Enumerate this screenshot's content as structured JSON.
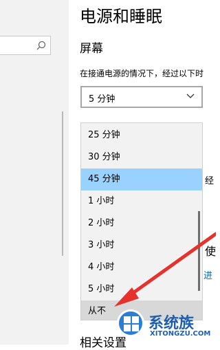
{
  "sidebar": {
    "search_icon": "search-icon"
  },
  "header": {
    "title": "电源和睡眠"
  },
  "screen": {
    "section_title": "屏幕",
    "description": "在接通电源的情况下，经过以下时",
    "select": {
      "value": "5 分钟",
      "icon": "chevron-down-icon"
    },
    "dropdown": {
      "options": [
        {
          "label": "25 分钟",
          "state": "normal"
        },
        {
          "label": "30 分钟",
          "state": "normal"
        },
        {
          "label": "45 分钟",
          "state": "selected"
        },
        {
          "label": "1 小时",
          "state": "normal"
        },
        {
          "label": "2 小时",
          "state": "normal"
        },
        {
          "label": "3 小时",
          "state": "normal"
        },
        {
          "label": "4 小时",
          "state": "normal"
        },
        {
          "label": "5 小时",
          "state": "normal"
        },
        {
          "label": "从不",
          "state": "hover"
        }
      ]
    }
  },
  "fragments": {
    "right_1": "经",
    "right_2": "使",
    "right_3": "进"
  },
  "related": {
    "title": "相关设置"
  },
  "watermark": {
    "name": "系统族",
    "domain": "XITONGZU.COM"
  },
  "colors": {
    "selected": "#99d1ff",
    "hover": "#d8d8d8",
    "arrow": "#e5322d",
    "link": "#0066b4"
  }
}
